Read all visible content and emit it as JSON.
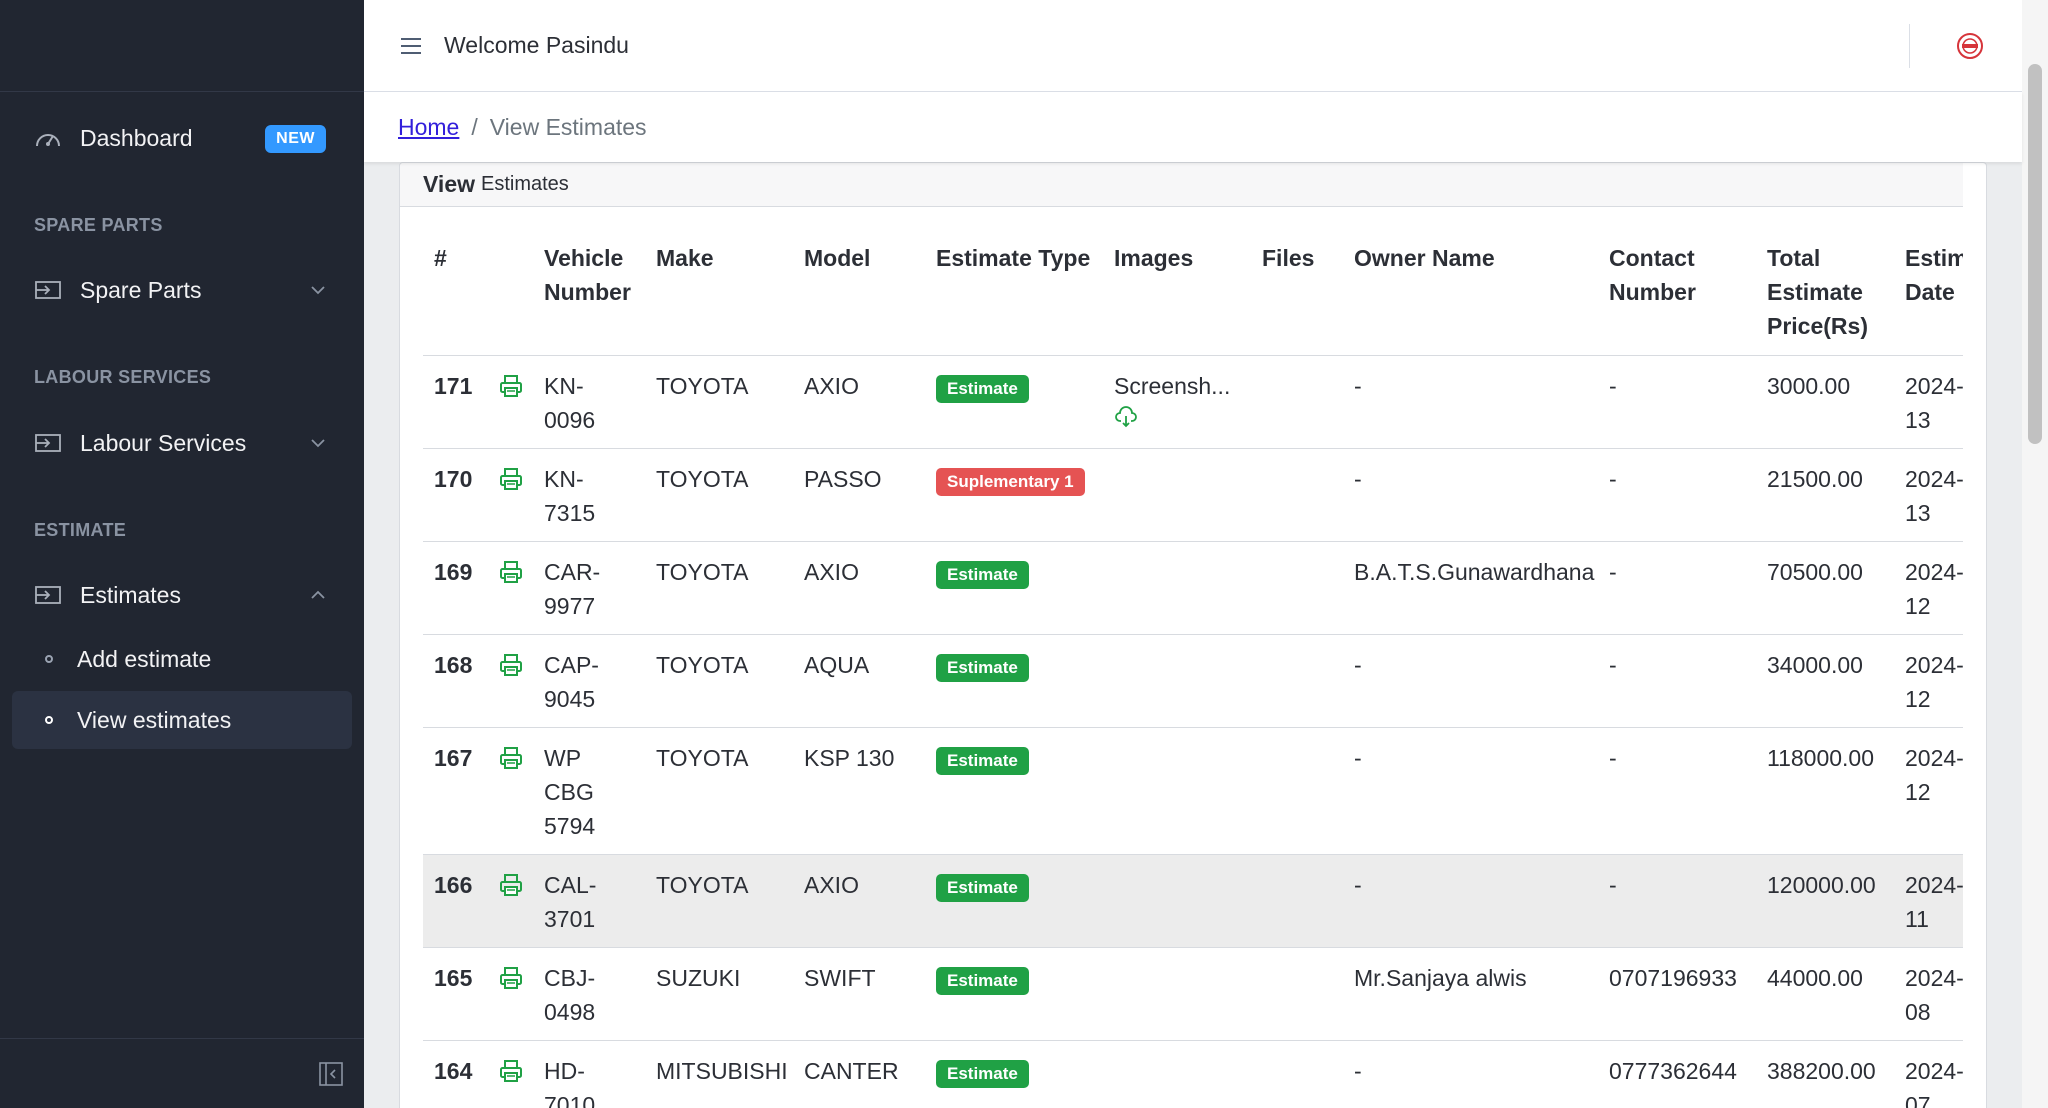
{
  "sidebar": {
    "dashboard_label": "Dashboard",
    "dashboard_badge": "NEW",
    "sections": [
      {
        "title": "SPARE PARTS",
        "item": "Spare Parts"
      },
      {
        "title": "LABOUR SERVICES",
        "item": "Labour Services"
      },
      {
        "title": "ESTIMATE",
        "item": "Estimates"
      }
    ],
    "sub_items": [
      "Add estimate",
      "View estimates"
    ]
  },
  "header": {
    "welcome": "Welcome Pasindu"
  },
  "breadcrumb": {
    "home": "Home",
    "separator": "/",
    "current": "View Estimates"
  },
  "card": {
    "title_strong": "View",
    "title_rest": "Estimates"
  },
  "table": {
    "headers": [
      "#",
      "",
      "Vehicle Number",
      "Make",
      "Model",
      "Estimate Type",
      "Images",
      "Files",
      "Owner Name",
      "Contact Number",
      "Total Estimate Price(Rs)",
      "Estim Date"
    ],
    "rows": [
      {
        "id": "171",
        "vehicle": "KN-0096",
        "make": "TOYOTA",
        "model": "AXIO",
        "type": "Estimate",
        "type_color": "green",
        "image": "Screensh...",
        "files": "",
        "owner": "-",
        "contact": "-",
        "total": "3000.00",
        "date_a": "2024-",
        "date_b": "13"
      },
      {
        "id": "170",
        "vehicle": "KN-7315",
        "make": "TOYOTA",
        "model": "PASSO",
        "type": "Suplementary 1",
        "type_color": "red",
        "image": "",
        "files": "",
        "owner": "-",
        "contact": "-",
        "total": "21500.00",
        "date_a": "2024-",
        "date_b": "13"
      },
      {
        "id": "169",
        "vehicle": "CAR-9977",
        "make": "TOYOTA",
        "model": "AXIO",
        "type": "Estimate",
        "type_color": "green",
        "image": "",
        "files": "",
        "owner": "B.A.T.S.Gunawardhana",
        "contact": "-",
        "total": "70500.00",
        "date_a": "2024-",
        "date_b": "12"
      },
      {
        "id": "168",
        "vehicle": "CAP-9045",
        "make": "TOYOTA",
        "model": "AQUA",
        "type": "Estimate",
        "type_color": "green",
        "image": "",
        "files": "",
        "owner": "-",
        "contact": "-",
        "total": "34000.00",
        "date_a": "2024-",
        "date_b": "12"
      },
      {
        "id": "167",
        "vehicle": "WP CBG 5794",
        "make": "TOYOTA",
        "model": "KSP 130",
        "type": "Estimate",
        "type_color": "green",
        "image": "",
        "files": "",
        "owner": "-",
        "contact": "-",
        "total": "118000.00",
        "date_a": "2024-",
        "date_b": "12"
      },
      {
        "id": "166",
        "vehicle": "CAL-3701",
        "make": "TOYOTA",
        "model": "AXIO",
        "type": "Estimate",
        "type_color": "green",
        "image": "",
        "files": "",
        "owner": "-",
        "contact": "-",
        "total": "120000.00",
        "date_a": "2024-",
        "date_b": "11"
      },
      {
        "id": "165",
        "vehicle": "CBJ-0498",
        "make": "SUZUKI",
        "model": "SWIFT",
        "type": "Estimate",
        "type_color": "green",
        "image": "",
        "files": "",
        "owner": "Mr.Sanjaya alwis",
        "contact": "0707196933",
        "total": "44000.00",
        "date_a": "2024-",
        "date_b": "08"
      },
      {
        "id": "164",
        "vehicle": "HD-7010",
        "make": "MITSUBISHI",
        "model": "CANTER",
        "type": "Estimate",
        "type_color": "green",
        "image": "",
        "files": "",
        "owner": "-",
        "contact": "0777362644",
        "total": "388200.00",
        "date_a": "2024-",
        "date_b": "07"
      }
    ]
  },
  "colors": {
    "sidebar_bg": "#212631",
    "badge_new": "#3399ff",
    "estimate_green": "#20a145",
    "suplementary_red": "#e55353",
    "link_blue": "#321fdb"
  },
  "icons": {
    "dashboard": "speedometer-icon",
    "section": "input-arrow-icon",
    "print": "printer-icon",
    "download": "cloud-download-icon",
    "menu": "hamburger-icon"
  }
}
